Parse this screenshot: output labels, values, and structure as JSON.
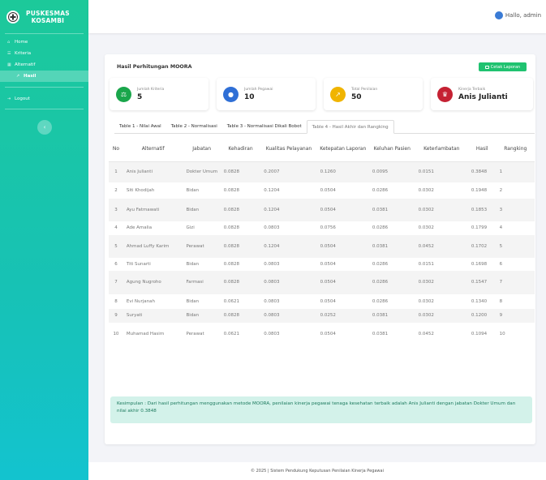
{
  "brand": {
    "line1": "PUSKESMAS",
    "line2": "KOSAMBI"
  },
  "sidebar": {
    "items": [
      {
        "label": "Home",
        "icon": "home-icon"
      },
      {
        "label": "Kriteria",
        "icon": "list-icon"
      },
      {
        "label": "Alternatif",
        "icon": "users-icon"
      },
      {
        "label": "Hasil",
        "icon": "chart-icon",
        "active": true
      },
      {
        "label": "Logout",
        "icon": "logout-icon"
      }
    ],
    "toggle": "‹"
  },
  "topbar": {
    "greeting": "Hallo, admin"
  },
  "card": {
    "title": "Hasil Perhitungan MOORA",
    "print_label": "Cetak Laporan"
  },
  "stats": [
    {
      "label": "Jumlah Kriteria",
      "value": "5",
      "color": "#1aa64b",
      "glyph": "⚖"
    },
    {
      "label": "Jumlah Pegawai",
      "value": "10",
      "color": "#2f6fd6",
      "glyph": "👥"
    },
    {
      "label": "Total Penilaian",
      "value": "50",
      "color": "#f0b400",
      "glyph": "📈"
    },
    {
      "label": "Kinerja Terbaik",
      "value": "Anis Julianti",
      "color": "#c52133",
      "glyph": "🏆"
    }
  ],
  "tabs": [
    "Table 1 - Nilai Awal",
    "Table 2 - Normalisasi",
    "Table 3 - Normalisasi Dikali Bobot",
    "Table 4 - Hasil Akhir dan Rangking"
  ],
  "table": {
    "headers": [
      "No",
      "Alternatif",
      "Jabatan",
      "Kehadiran",
      "Kualitas Pelayanan",
      "Ketepatan Laporan",
      "Keluhan Pasien",
      "Keterlambatan",
      "Hasil",
      "Rangking"
    ],
    "rows": [
      [
        "1",
        "Anis Julianti",
        "Dokter Umum",
        "0.0828",
        "0.2007",
        "0.1260",
        "0.0095",
        "0.0151",
        "0.3848",
        "1"
      ],
      [
        "2",
        "Siti Khodijah",
        "Bidan",
        "0.0828",
        "0.1204",
        "0.0504",
        "0.0286",
        "0.0302",
        "0.1948",
        "2"
      ],
      [
        "3",
        "Ayu Fatmawati",
        "Bidan",
        "0.0828",
        "0.1204",
        "0.0504",
        "0.0381",
        "0.0302",
        "0.1853",
        "3"
      ],
      [
        "4",
        "Ade Amalia",
        "Gizi",
        "0.0828",
        "0.0803",
        "0.0756",
        "0.0286",
        "0.0302",
        "0.1799",
        "4"
      ],
      [
        "5",
        "Ahmad Luffy Karim",
        "Perawat",
        "0.0828",
        "0.1204",
        "0.0504",
        "0.0381",
        "0.0452",
        "0.1702",
        "5"
      ],
      [
        "6",
        "Titi Sunarti",
        "Bidan",
        "0.0828",
        "0.0803",
        "0.0504",
        "0.0286",
        "0.0151",
        "0.1698",
        "6"
      ],
      [
        "7",
        "Agung Nugroho",
        "Farmasi",
        "0.0828",
        "0.0803",
        "0.0504",
        "0.0286",
        "0.0302",
        "0.1547",
        "7"
      ],
      [
        "8",
        "Evi Nurjanah",
        "Bidan",
        "0.0621",
        "0.0803",
        "0.0504",
        "0.0286",
        "0.0302",
        "0.1340",
        "8"
      ],
      [
        "9",
        "Suryati",
        "Bidan",
        "0.0828",
        "0.0803",
        "0.0252",
        "0.0381",
        "0.0302",
        "0.1200",
        "9"
      ],
      [
        "10",
        "Muhamad Hasim",
        "Perawat",
        "0.0621",
        "0.0803",
        "0.0504",
        "0.0381",
        "0.0452",
        "0.1094",
        "10"
      ]
    ]
  },
  "conclusion": "Kesimpulan : Dari hasil perhitungan menggunakan metode MOORA, penilaian kinerja pegawai tenaga kesehatan terbaik adalah Anis Julianti dengan jabatan Dokter Umum dan nilai akhir 0.3848",
  "footer": "© 2025 | Sistem Pendukung Keputusan Penilaian Kinerja Pegawai"
}
